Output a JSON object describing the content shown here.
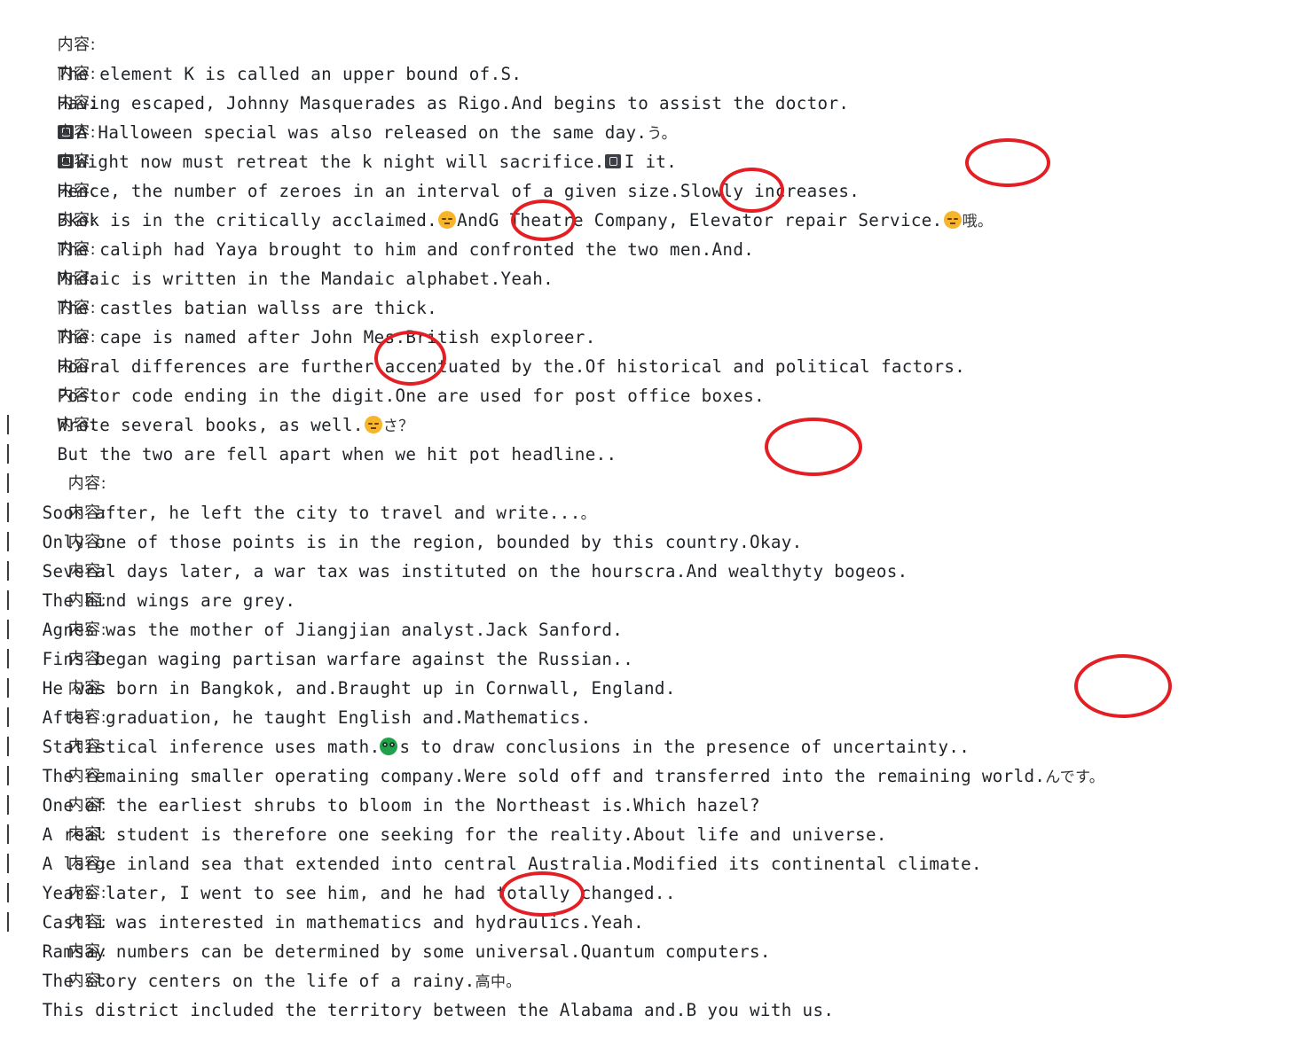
{
  "console": {
    "prefix": "内容:",
    "lines": [
      {
        "text": "The element K is called an upper bound of.S."
      },
      {
        "text": "Having escaped, Johnny Masquerades as Rigo.And begins to assist the doctor."
      },
      {
        "text": "A Halloween special was also released on the same day.",
        "tail": "う。"
      },
      {
        "text": "Wight now must retreat the k night will sacrifice.",
        "tail": "I it."
      },
      {
        "text": "Hence, the number of zeroes in an interval of a given size.Slowly increases."
      },
      {
        "text": "Bkok is in the critically acclaimed.",
        "mid": "AndG Theatre Company, Elevator repair Service.",
        "tail": "哦。"
      },
      {
        "text": "The caliph had Yaya brought to him and confronted the two men.And."
      },
      {
        "text": "Mndaic is written in the Mandaic alphabet.Yeah."
      },
      {
        "text": "The castles batian wallss are thick."
      },
      {
        "text": "The cape is named after John Mes.British exploreer."
      },
      {
        "text": "Houral differences are further accentuated by the.Of historical and political factors."
      },
      {
        "text": "Postor code ending in the digit.One are used for post office boxes."
      },
      {
        "text": "Wrote several books, as well.",
        "tail": "さ？"
      },
      {
        "text": "But the two are fell apart when we hit pot headline.."
      },
      {
        "text": "Soon after, he left the city to travel and write...",
        "tail": "。"
      },
      {
        "text": "Only one of those points is in the region, bounded by this country.Okay."
      },
      {
        "text": "Several days later, a war tax was instituted on the hourscra.And wealthyty bogeos."
      },
      {
        "text": "The hind wings are grey."
      },
      {
        "text": "Agnes was the mother of Jiangjian analyst.Jack Sanford."
      },
      {
        "text": "Fins began waging partisan warfare against the Russian.."
      },
      {
        "text": "He was born in Bangkok, and.Braught up in Cornwall, England."
      },
      {
        "text": "After graduation, he taught English and.Mathematics."
      },
      {
        "text": "Statistical inference uses math.",
        "tail": "s to draw conclusions in the presence of uncertainty.."
      },
      {
        "text": "The remaining smaller operating company.Were sold off and transferred into the remaining world.",
        "tail": "んです。"
      },
      {
        "text": "One of the earliest shrubs to bloom in the Northeast is.Which hazel?"
      },
      {
        "text": "A real student is therefore one seeking for the reality.About life and universe."
      },
      {
        "text": "A large inland sea that extended into central Australia.Modified its continental climate."
      },
      {
        "text": "Years later, I went to see him, and he had totally changed.."
      },
      {
        "text": "Castli was interested in mathematics and hydraulics.Yeah."
      },
      {
        "text": "Ramsay numbers can be determined by some universal.Quantum computers."
      },
      {
        "text": "The story centers on the life of a rainy.",
        "tail": "高中。"
      },
      {
        "text": "This district included the territory between the Alabama and.B you with us."
      }
    ]
  },
  "colors": {
    "annotation_circle": "#e31e24",
    "text": "#1f2328",
    "background": "#ffffff"
  }
}
